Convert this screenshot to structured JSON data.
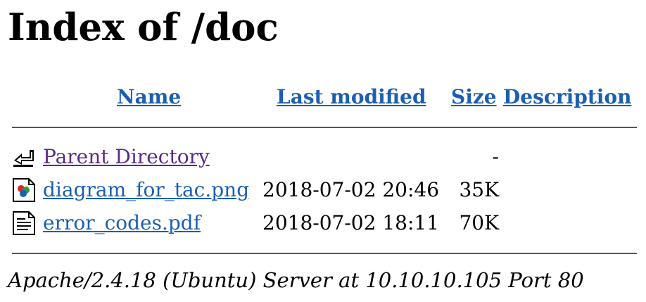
{
  "page_title": "Index of /doc",
  "columns": {
    "name": "Name",
    "last_modified": "Last modified",
    "size": "Size",
    "description": "Description"
  },
  "rows": [
    {
      "name": "Parent Directory",
      "last_modified": "",
      "size": "-",
      "description": "",
      "icon": "back-arrow-icon"
    },
    {
      "name": "diagram_for_tac.png",
      "last_modified": "2018-07-02 20:46",
      "size": "35K",
      "description": "",
      "icon": "image-file-icon"
    },
    {
      "name": "error_codes.pdf",
      "last_modified": "2018-07-02 18:11",
      "size": "70K",
      "description": "",
      "icon": "text-file-icon"
    }
  ],
  "footer": "Apache/2.4.18 (Ubuntu) Server at 10.10.10.105 Port 80",
  "colors": {
    "link": "#1a5fb4",
    "visited_link": "#5b2a86",
    "rule": "#555555"
  }
}
